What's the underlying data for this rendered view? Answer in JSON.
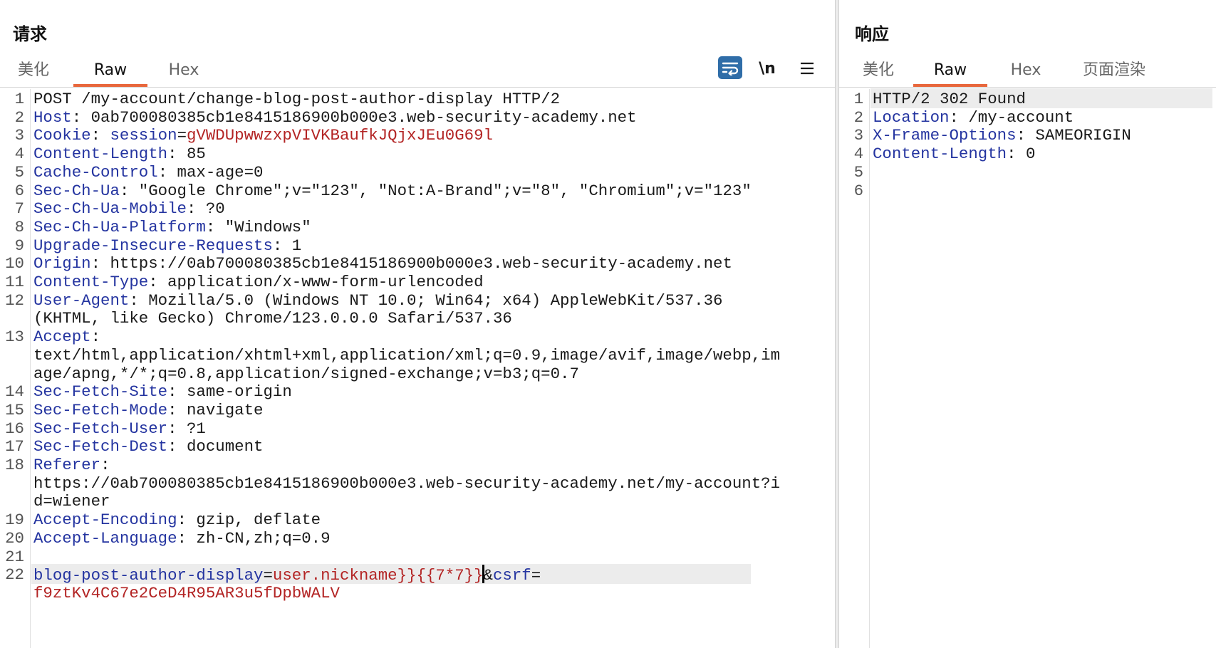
{
  "request": {
    "title": "请求",
    "tabs": [
      {
        "label": "美化",
        "active": false
      },
      {
        "label": "Raw",
        "active": true
      },
      {
        "label": "Hex",
        "active": false
      }
    ],
    "tools": {
      "wrap_icon": "wrap-lines-icon",
      "newline_label": "\\n",
      "menu_icon": "hamburger-menu-icon"
    },
    "lines": [
      {
        "n": "1",
        "parts": [
          {
            "t": "POST /my-account/change-blog-post-author-display HTTP/2",
            "c": "p"
          }
        ]
      },
      {
        "n": "2",
        "parts": [
          {
            "t": "Host",
            "c": "k"
          },
          {
            "t": ": 0ab700080385cb1e8415186900b000e3.web-security-academy.net",
            "c": "p"
          }
        ]
      },
      {
        "n": "3",
        "parts": [
          {
            "t": "Cookie",
            "c": "k"
          },
          {
            "t": ": ",
            "c": "p"
          },
          {
            "t": "session",
            "c": "k"
          },
          {
            "t": "=",
            "c": "p"
          },
          {
            "t": "gVWDUpwwzxpVIVKBaufkJQjxJEu0G69l",
            "c": "v"
          }
        ]
      },
      {
        "n": "4",
        "parts": [
          {
            "t": "Content-Length",
            "c": "k"
          },
          {
            "t": ": 85",
            "c": "p"
          }
        ]
      },
      {
        "n": "5",
        "parts": [
          {
            "t": "Cache-Control",
            "c": "k"
          },
          {
            "t": ": max-age=0",
            "c": "p"
          }
        ]
      },
      {
        "n": "6",
        "parts": [
          {
            "t": "Sec-Ch-Ua",
            "c": "k"
          },
          {
            "t": ": \"Google Chrome\";v=\"123\", \"Not:A-Brand\";v=\"8\", \"Chromium\";v=\"123\"",
            "c": "p"
          }
        ]
      },
      {
        "n": "7",
        "parts": [
          {
            "t": "Sec-Ch-Ua-Mobile",
            "c": "k"
          },
          {
            "t": ": ?0",
            "c": "p"
          }
        ]
      },
      {
        "n": "8",
        "parts": [
          {
            "t": "Sec-Ch-Ua-Platform",
            "c": "k"
          },
          {
            "t": ": \"Windows\"",
            "c": "p"
          }
        ]
      },
      {
        "n": "9",
        "parts": [
          {
            "t": "Upgrade-Insecure-Requests",
            "c": "k"
          },
          {
            "t": ": 1",
            "c": "p"
          }
        ]
      },
      {
        "n": "10",
        "parts": [
          {
            "t": "Origin",
            "c": "k"
          },
          {
            "t": ": https://0ab700080385cb1e8415186900b000e3.web-security-academy.net",
            "c": "p"
          }
        ]
      },
      {
        "n": "11",
        "parts": [
          {
            "t": "Content-Type",
            "c": "k"
          },
          {
            "t": ": application/x-www-form-urlencoded",
            "c": "p"
          }
        ]
      },
      {
        "n": "12",
        "parts": [
          {
            "t": "User-Agent",
            "c": "k"
          },
          {
            "t": ": Mozilla/5.0 (Windows NT 10.0; Win64; x64) AppleWebKit/537.36",
            "c": "p"
          }
        ]
      },
      {
        "n": "",
        "parts": [
          {
            "t": "(KHTML, like Gecko) Chrome/123.0.0.0 Safari/537.36",
            "c": "p"
          }
        ]
      },
      {
        "n": "13",
        "parts": [
          {
            "t": "Accept",
            "c": "k"
          },
          {
            "t": ":",
            "c": "p"
          }
        ]
      },
      {
        "n": "",
        "parts": [
          {
            "t": "text/html,application/xhtml+xml,application/xml;q=0.9,image/avif,image/webp,im",
            "c": "p"
          }
        ]
      },
      {
        "n": "",
        "parts": [
          {
            "t": "age/apng,*/*;q=0.8,application/signed-exchange;v=b3;q=0.7",
            "c": "p"
          }
        ]
      },
      {
        "n": "14",
        "parts": [
          {
            "t": "Sec-Fetch-Site",
            "c": "k"
          },
          {
            "t": ": same-origin",
            "c": "p"
          }
        ]
      },
      {
        "n": "15",
        "parts": [
          {
            "t": "Sec-Fetch-Mode",
            "c": "k"
          },
          {
            "t": ": navigate",
            "c": "p"
          }
        ]
      },
      {
        "n": "16",
        "parts": [
          {
            "t": "Sec-Fetch-User",
            "c": "k"
          },
          {
            "t": ": ?1",
            "c": "p"
          }
        ]
      },
      {
        "n": "17",
        "parts": [
          {
            "t": "Sec-Fetch-Dest",
            "c": "k"
          },
          {
            "t": ": document",
            "c": "p"
          }
        ]
      },
      {
        "n": "18",
        "parts": [
          {
            "t": "Referer",
            "c": "k"
          },
          {
            "t": ":",
            "c": "p"
          }
        ]
      },
      {
        "n": "",
        "parts": [
          {
            "t": "https://0ab700080385cb1e8415186900b000e3.web-security-academy.net/my-account?i",
            "c": "p"
          }
        ]
      },
      {
        "n": "",
        "parts": [
          {
            "t": "d=wiener",
            "c": "p"
          }
        ]
      },
      {
        "n": "19",
        "parts": [
          {
            "t": "Accept-Encoding",
            "c": "k"
          },
          {
            "t": ": gzip, deflate",
            "c": "p"
          }
        ]
      },
      {
        "n": "20",
        "parts": [
          {
            "t": "Accept-Language",
            "c": "k"
          },
          {
            "t": ": zh-CN,zh;q=0.9",
            "c": "p"
          }
        ]
      },
      {
        "n": "21",
        "parts": []
      },
      {
        "n": "22",
        "highlight": true,
        "parts": [
          {
            "t": "blog-post-author-display",
            "c": "k"
          },
          {
            "t": "=",
            "c": "p"
          },
          {
            "t": "user.nickname}}{{7*7}}",
            "c": "v"
          },
          {
            "t": "",
            "c": "caret"
          },
          {
            "t": "&",
            "c": "p"
          },
          {
            "t": "csrf",
            "c": "k"
          },
          {
            "t": "=",
            "c": "p"
          }
        ]
      },
      {
        "n": "",
        "parts": [
          {
            "t": "f9ztKv4C67e2CeD4R95AR3u5fDpbWALV",
            "c": "v"
          }
        ]
      }
    ]
  },
  "response": {
    "title": "响应",
    "tabs": [
      {
        "label": "美化",
        "active": false
      },
      {
        "label": "Raw",
        "active": true
      },
      {
        "label": "Hex",
        "active": false
      },
      {
        "label": "页面渲染",
        "active": false
      }
    ],
    "lines": [
      {
        "n": "1",
        "highlight": true,
        "parts": [
          {
            "t": "HTTP/2 302 Found",
            "c": "p"
          }
        ]
      },
      {
        "n": "2",
        "parts": [
          {
            "t": "Location",
            "c": "k"
          },
          {
            "t": ": /my-account",
            "c": "p"
          }
        ]
      },
      {
        "n": "3",
        "parts": [
          {
            "t": "X-Frame-Options",
            "c": "k"
          },
          {
            "t": ": SAMEORIGIN",
            "c": "p"
          }
        ]
      },
      {
        "n": "4",
        "parts": [
          {
            "t": "Content-Length",
            "c": "k"
          },
          {
            "t": ": 0",
            "c": "p"
          }
        ]
      },
      {
        "n": "5",
        "parts": []
      },
      {
        "n": "6",
        "parts": []
      }
    ]
  },
  "colors": {
    "key": "#2434a0",
    "value": "#b32424",
    "accent": "#e8673c",
    "wrap_button": "#2f6da8"
  }
}
